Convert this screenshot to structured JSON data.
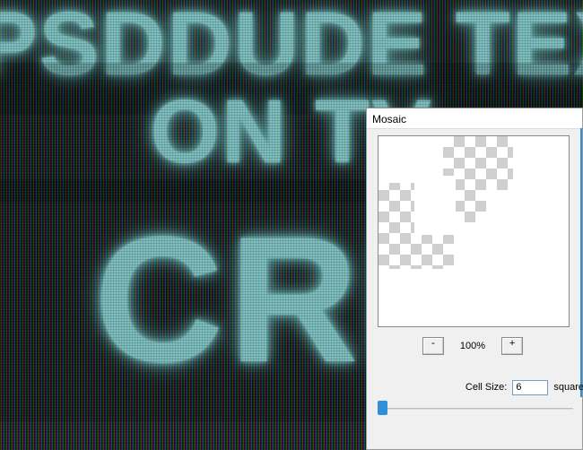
{
  "artwork": {
    "line1": "PSDDUDE TEXT",
    "line2": "ON TV",
    "line3": "CRE"
  },
  "dialog": {
    "title": "Mosaic",
    "zoom_out_label": "-",
    "zoom_in_label": "+",
    "zoom_value": "100%",
    "cell_size_label": "Cell Size:",
    "cell_size_value": "6",
    "cell_size_unit": "square"
  }
}
